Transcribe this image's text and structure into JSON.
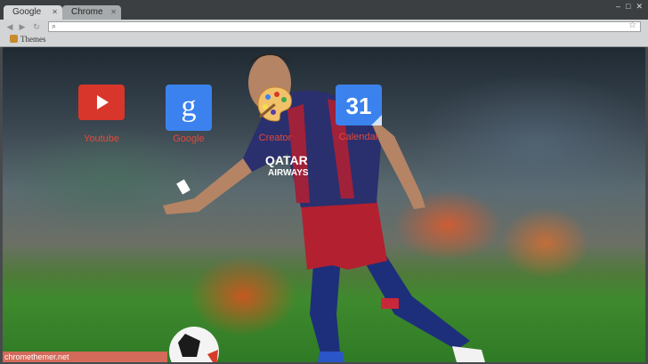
{
  "tabs": [
    {
      "label": "Google"
    },
    {
      "label": "Chrome"
    }
  ],
  "bookmarks": {
    "items": [
      {
        "label": "Themes"
      }
    ]
  },
  "apps": [
    {
      "label": "Youtube"
    },
    {
      "label": "Google"
    },
    {
      "label": "Creator"
    },
    {
      "label": "Calendar"
    }
  ],
  "calendar_day": "31",
  "google_glyph": "g",
  "status_bar": {
    "text": "chromethemer.net"
  },
  "colors": {
    "accent": "#e24a3a",
    "app_blue": "#3b82ee",
    "youtube_red": "#d9362b"
  }
}
